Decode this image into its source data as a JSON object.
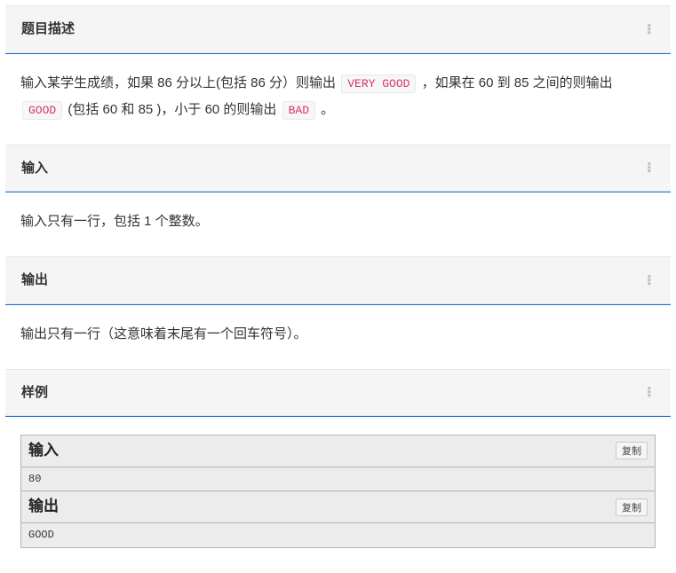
{
  "sections": {
    "description": {
      "title": "题目描述",
      "text_parts": [
        "输入某学生成绩，如果 86 分以上(包括 86 分）则输出 ",
        " ，如果在 60 到 85 之间的则输出 ",
        " (包括 60 和 85 )，小于 60 的则输出 ",
        " 。"
      ],
      "codes": [
        "VERY GOOD",
        "GOOD",
        "BAD"
      ]
    },
    "input": {
      "title": "输入",
      "text": "输入只有一行，包括 1 个整数。"
    },
    "output": {
      "title": "输出",
      "text": "输出只有一行（这意味着末尾有一个回车符号）。"
    },
    "sample": {
      "title": "样例",
      "input_label": "输入",
      "output_label": "输出",
      "copy_label": "复制",
      "input_data": "80",
      "output_data": "GOOD"
    }
  }
}
